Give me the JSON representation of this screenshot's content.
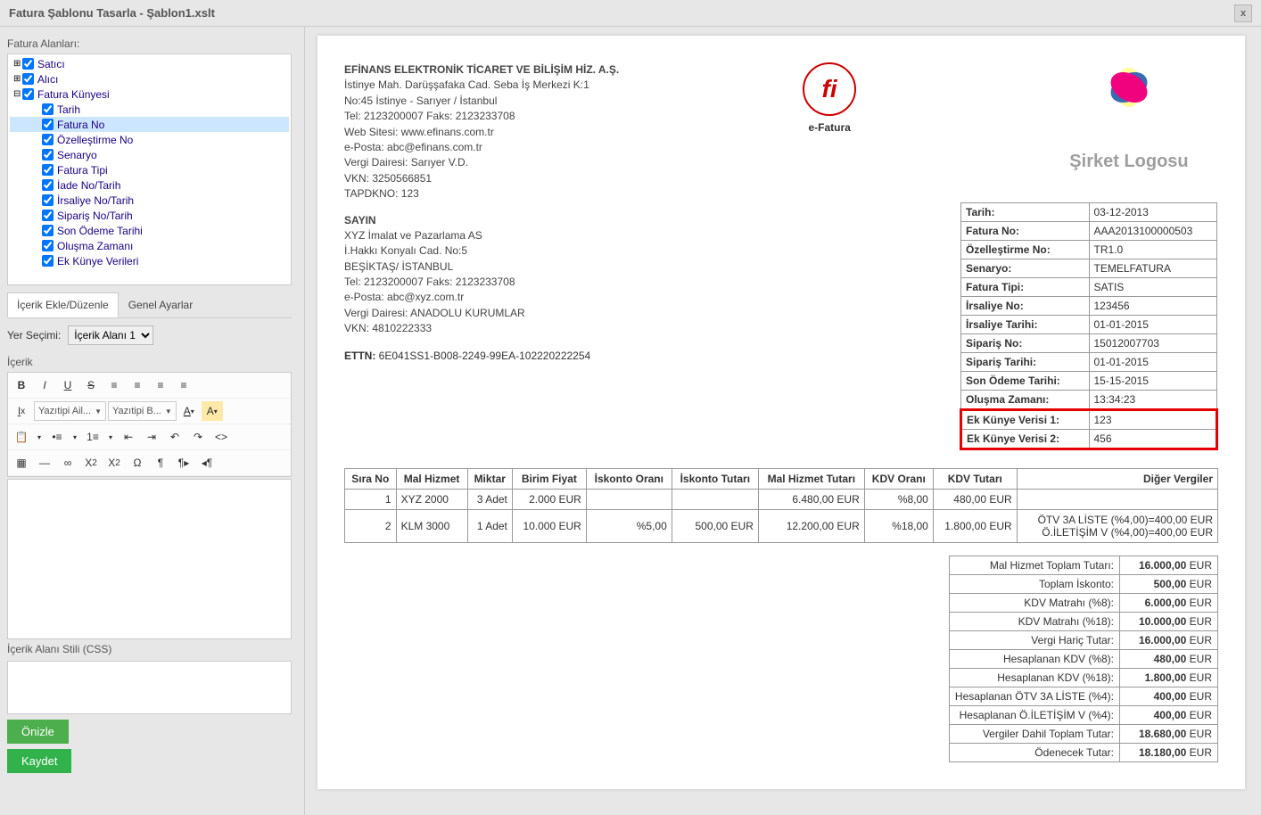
{
  "window_title": "Fatura Şablonu Tasarla - Şablon1.xslt",
  "sidebar": {
    "fields_label": "Fatura Alanları:",
    "tree": [
      {
        "label": "Satıcı",
        "level": 0,
        "checked": true,
        "exp": "+"
      },
      {
        "label": "Alıcı",
        "level": 0,
        "checked": true,
        "exp": "+"
      },
      {
        "label": "Fatura Künyesi",
        "level": 0,
        "checked": true,
        "exp": "-"
      },
      {
        "label": "Tarih",
        "level": 1,
        "checked": true
      },
      {
        "label": "Fatura No",
        "level": 1,
        "checked": true,
        "selected": true
      },
      {
        "label": "Özelleştirme No",
        "level": 1,
        "checked": true
      },
      {
        "label": "Senaryo",
        "level": 1,
        "checked": true
      },
      {
        "label": "Fatura Tipi",
        "level": 1,
        "checked": true
      },
      {
        "label": "İade No/Tarih",
        "level": 1,
        "checked": true
      },
      {
        "label": "İrsaliye No/Tarih",
        "level": 1,
        "checked": true
      },
      {
        "label": "Sipariş No/Tarih",
        "level": 1,
        "checked": true
      },
      {
        "label": "Son Ödeme Tarihi",
        "level": 1,
        "checked": true
      },
      {
        "label": "Oluşma Zamanı",
        "level": 1,
        "checked": true
      },
      {
        "label": "Ek Künye Verileri",
        "level": 1,
        "checked": true
      }
    ],
    "tab_content": "İçerik Ekle/Düzenle",
    "tab_general": "Genel Ayarlar",
    "place_label": "Yer Seçimi:",
    "place_value": "İçerik Alanı 1",
    "content_label": "İçerik",
    "toolbar": {
      "font_family": "Yazıtipi Ail...",
      "font_size": "Yazıtipi B..."
    },
    "css_label": "İçerik Alanı Stili (CSS)",
    "btn_preview": "Önizle",
    "btn_save": "Kaydet"
  },
  "invoice": {
    "company": {
      "name": "EFİNANS ELEKTRONİK TİCARET VE BİLİŞİM HİZ. A.Ş.",
      "addr1": "İstinye Mah. Darüşşafaka Cad. Seba İş Merkezi K:1",
      "addr2": "No:45 İstinye - Sarıyer / İstanbul",
      "tel": "Tel: 2123200007 Faks: 2123233708",
      "web": "Web Sitesi: www.efinans.com.tr",
      "email": "e-Posta: abc@efinans.com.tr",
      "taxoffice": "Vergi Dairesi: Sarıyer V.D.",
      "vkn": "VKN: 3250566851",
      "tapdk": "TAPDKNO: 123"
    },
    "efatura_label": "e-Fatura",
    "logo_label": "Şirket Logosu",
    "recipient": {
      "sayin": "SAYIN",
      "name": "XYZ İmalat ve Pazarlama AS",
      "addr1": "İ.Hakkı Konyalı Cad.  No:5",
      "addr2": "BEŞİKTAŞ/ İSTANBUL",
      "tel": "Tel: 2123200007 Faks: 2123233708",
      "email": "e-Posta: abc@xyz.com.tr",
      "taxoffice": "Vergi Dairesi: ANADOLU KURUMLAR",
      "vkn": "VKN: 4810222333"
    },
    "ettn_label": "ETTN:",
    "ettn_value": "6E041SS1-B008-2249-99EA-102220222254",
    "meta": [
      {
        "k": "Tarih:",
        "v": "03-12-2013"
      },
      {
        "k": "Fatura No:",
        "v": "AAA2013100000503"
      },
      {
        "k": "Özelleştirme No:",
        "v": "TR1.0"
      },
      {
        "k": "Senaryo:",
        "v": "TEMELFATURA"
      },
      {
        "k": "Fatura Tipi:",
        "v": "SATIS"
      },
      {
        "k": "İrsaliye No:",
        "v": "123456"
      },
      {
        "k": "İrsaliye Tarihi:",
        "v": "01-01-2015"
      },
      {
        "k": "Sipariş No:",
        "v": "15012007703"
      },
      {
        "k": "Sipariş Tarihi:",
        "v": "01-01-2015"
      },
      {
        "k": "Son Ödeme Tarihi:",
        "v": "15-15-2015"
      },
      {
        "k": "Oluşma Zamanı:",
        "v": "13:34:23"
      },
      {
        "k": "Ek Künye Verisi 1:",
        "v": "123",
        "hl": true
      },
      {
        "k": "Ek Künye Verisi 2:",
        "v": "456",
        "hl": true
      }
    ],
    "line_headers": [
      "Sıra No",
      "Mal Hizmet",
      "Miktar",
      "Birim Fiyat",
      "İskonto Oranı",
      "İskonto Tutarı",
      "Mal Hizmet Tutarı",
      "KDV Oranı",
      "KDV Tutarı",
      "Diğer Vergiler"
    ],
    "lines": [
      {
        "no": "1",
        "name": "XYZ 2000",
        "qty": "3 Adet",
        "unit": "2.000 EUR",
        "disc_rate": "",
        "disc_amt": "",
        "line_total": "6.480,00 EUR",
        "vat_rate": "%8,00",
        "vat_amt": "480,00 EUR",
        "other": ""
      },
      {
        "no": "2",
        "name": "KLM 3000",
        "qty": "1 Adet",
        "unit": "10.000 EUR",
        "disc_rate": "%5,00",
        "disc_amt": "500,00 EUR",
        "line_total": "12.200,00 EUR",
        "vat_rate": "%18,00",
        "vat_amt": "1.800,00 EUR",
        "other": "ÖTV 3A LİSTE (%4,00)=400,00 EUR\nÖ.İLETİŞİM V (%4,00)=400,00 EUR"
      }
    ],
    "totals": [
      {
        "k": "Mal Hizmet Toplam Tutarı:",
        "v": "16.000,00",
        "c": "EUR",
        "b": true
      },
      {
        "k": "Toplam İskonto:",
        "v": "500,00",
        "c": "EUR",
        "b": true
      },
      {
        "k": "KDV Matrahı (%8):",
        "v": "6.000,00",
        "c": "EUR",
        "b": true
      },
      {
        "k": "KDV Matrahı (%18):",
        "v": "10.000,00",
        "c": "EUR",
        "b": true
      },
      {
        "k": "Vergi Hariç Tutar:",
        "v": "16.000,00",
        "c": "EUR",
        "b": true
      },
      {
        "k": "Hesaplanan KDV (%8):",
        "v": "480,00",
        "c": "EUR",
        "b": true
      },
      {
        "k": "Hesaplanan KDV (%18):",
        "v": "1.800,00",
        "c": "EUR",
        "b": true
      },
      {
        "k": "Hesaplanan ÖTV 3A LİSTE (%4):",
        "v": "400,00",
        "c": "EUR",
        "b": true
      },
      {
        "k": "Hesaplanan Ö.İLETİŞİM V (%4):",
        "v": "400,00",
        "c": "EUR",
        "b": true
      },
      {
        "k": "Vergiler Dahil Toplam Tutar:",
        "v": "18.680,00",
        "c": "EUR",
        "b": true
      },
      {
        "k": "Ödenecek Tutar:",
        "v": "18.180,00",
        "c": "EUR",
        "b": true
      }
    ]
  }
}
